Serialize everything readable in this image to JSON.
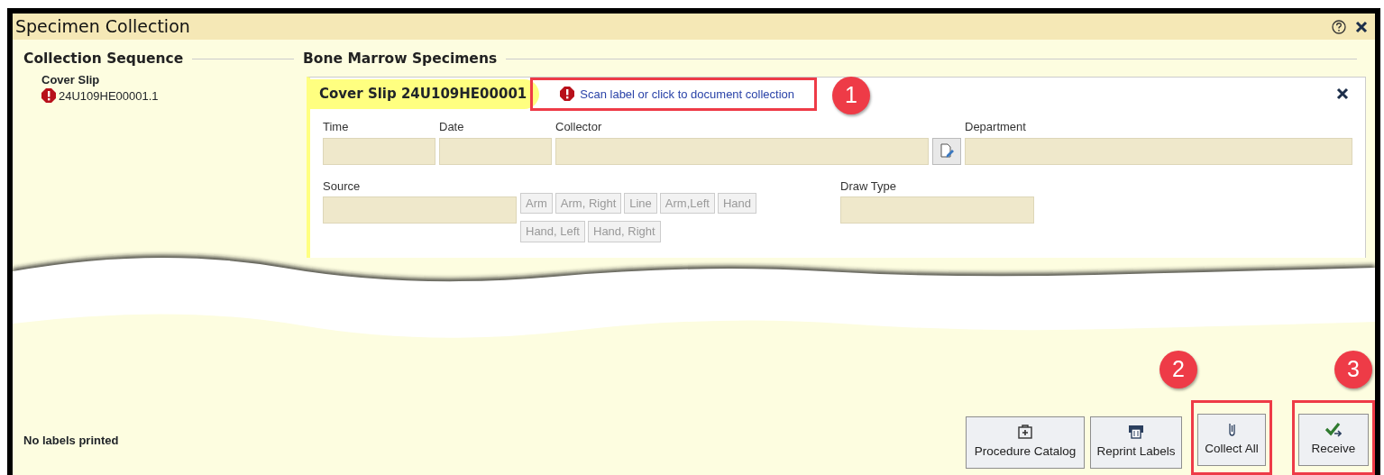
{
  "window": {
    "title": "Specimen Collection"
  },
  "sequence": {
    "heading": "Collection Sequence",
    "items": [
      {
        "name": "Cover Slip",
        "specimen_id": "24U109HE00001.1",
        "alert": true
      }
    ]
  },
  "specimens": {
    "heading": "Bone Marrow Specimens",
    "card": {
      "title": "Cover Slip 24U109HE00001",
      "link": {
        "text": "Scan label or click to document collection",
        "alert": true,
        "callout": "1"
      },
      "row_1": [
        {
          "label": "Time",
          "kind": "text"
        },
        {
          "label": "Date",
          "kind": "text"
        },
        {
          "label": "Collector",
          "kind": "lookup"
        },
        {
          "label": "Department",
          "kind": "text"
        }
      ],
      "source": {
        "label": "Source",
        "options": [
          {
            "label": "Arm",
            "disabled": true
          },
          {
            "label": "Arm, Right",
            "disabled": true
          },
          {
            "label": "Line",
            "disabled": true
          },
          {
            "label": "Arm,Left",
            "disabled": true
          },
          {
            "label": "Hand",
            "disabled": true
          },
          {
            "label": "Hand, Left",
            "disabled": true
          },
          {
            "label": "Hand, Right",
            "disabled": true
          }
        ]
      },
      "draw_type": {
        "label": "Draw Type"
      }
    }
  },
  "footer": {
    "status": "No labels printed",
    "buttons": [
      {
        "label": "Procedure Catalog",
        "kind": "kit"
      },
      {
        "label": "Reprint Labels",
        "kind": "printer"
      },
      {
        "label": "Collect All",
        "kind": "clip",
        "callout": "2"
      },
      {
        "label": "Receive",
        "kind": "check",
        "callout": "3"
      }
    ]
  }
}
